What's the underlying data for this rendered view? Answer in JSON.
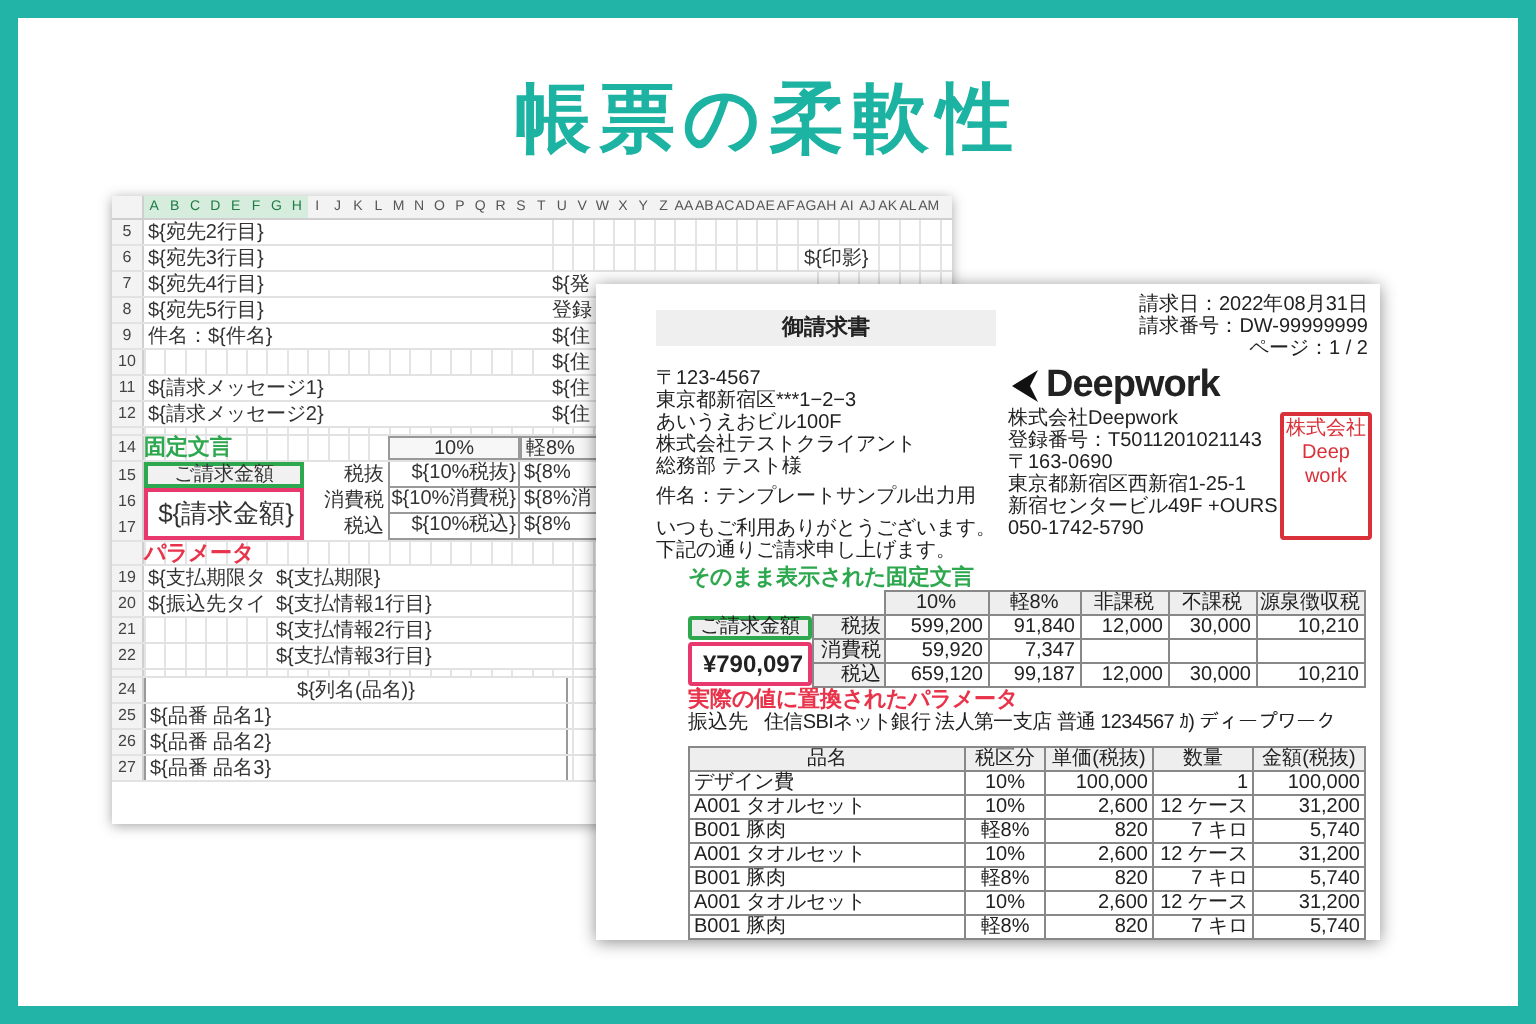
{
  "banner_title": "帳票の柔軟性",
  "spreadsheet": {
    "columns": [
      {
        "label": "A",
        "selected": true
      },
      {
        "label": "B",
        "selected": true
      },
      {
        "label": "C",
        "selected": true
      },
      {
        "label": "D",
        "selected": true
      },
      {
        "label": "E",
        "selected": true
      },
      {
        "label": "F",
        "selected": true
      },
      {
        "label": "G",
        "selected": true
      },
      {
        "label": "H",
        "selected": true
      },
      {
        "label": "I",
        "selected": false
      },
      {
        "label": "J",
        "selected": false
      },
      {
        "label": "K",
        "selected": false
      },
      {
        "label": "L",
        "selected": false
      },
      {
        "label": "M",
        "selected": false
      },
      {
        "label": "N",
        "selected": false
      },
      {
        "label": "O",
        "selected": false
      },
      {
        "label": "P",
        "selected": false
      },
      {
        "label": "Q",
        "selected": false
      },
      {
        "label": "R",
        "selected": false
      },
      {
        "label": "S",
        "selected": false
      },
      {
        "label": "T",
        "selected": false
      },
      {
        "label": "U",
        "selected": false
      },
      {
        "label": "V",
        "selected": false
      },
      {
        "label": "W",
        "selected": false
      },
      {
        "label": "X",
        "selected": false
      },
      {
        "label": "Y",
        "selected": false
      },
      {
        "label": "Z",
        "selected": false
      },
      {
        "label": "AA",
        "selected": false
      },
      {
        "label": "AB",
        "selected": false
      },
      {
        "label": "AC",
        "selected": false
      },
      {
        "label": "AD",
        "selected": false
      },
      {
        "label": "AE",
        "selected": false
      },
      {
        "label": "AF",
        "selected": false
      },
      {
        "label": "AG",
        "selected": false
      },
      {
        "label": "AH",
        "selected": false
      },
      {
        "label": "AI",
        "selected": false
      },
      {
        "label": "AJ",
        "selected": false
      },
      {
        "label": "AK",
        "selected": false
      },
      {
        "label": "AL",
        "selected": false
      },
      {
        "label": "AM",
        "selected": false
      }
    ],
    "rows": [
      {
        "number": "5",
        "left": "${宛先2行目}"
      },
      {
        "number": "6",
        "left": "${宛先3行目}",
        "far": "${印影}"
      },
      {
        "number": "7",
        "left": "${宛先4行目}",
        "right": "${発"
      },
      {
        "number": "8",
        "left": "${宛先5行目}",
        "right": "登録"
      },
      {
        "number": "9",
        "left": "件名：${件名}",
        "right": "${住"
      },
      {
        "number": "10",
        "right": "${住"
      },
      {
        "number": "11",
        "left": "${請求メッセージ1}",
        "right": "${住"
      },
      {
        "number": "12",
        "left": "${請求メッセージ2}",
        "right": "${住"
      }
    ],
    "summary": {
      "row_numbers": [
        "14",
        "15",
        "16",
        "17"
      ],
      "annotation_fixed": "固定文言",
      "headers": [
        "10%",
        "軽8%"
      ],
      "fixed_label": "ご請求金額",
      "amount": "${請求金額}",
      "annotation_param": "パラメータ",
      "rows": [
        {
          "tax_label": "税抜",
          "values": [
            "${10%税抜}",
            "${8%"
          ]
        },
        {
          "tax_label": "消費税",
          "values": [
            "${10%消費税}",
            "${8%消"
          ]
        },
        {
          "tax_label": "税込",
          "values": [
            "${10%税込}",
            "${8%"
          ]
        }
      ]
    },
    "payment_rows": [
      {
        "number": "19",
        "label": "${支払期限タ",
        "value": "${支払期限}"
      },
      {
        "number": "20",
        "label": "${振込先タイ",
        "value": "${支払情報1行目}"
      },
      {
        "number": "21",
        "value": "${支払情報2行目}"
      },
      {
        "number": "22",
        "value": "${支払情報3行目}"
      }
    ],
    "item_header": {
      "number": "24",
      "text": "${列名(品名)}"
    },
    "item_rows": [
      {
        "number": "25",
        "text": "${品番 品名1}"
      },
      {
        "number": "26",
        "text": "${品番 品名2}"
      },
      {
        "number": "27",
        "text": "${品番 品名3}"
      }
    ]
  },
  "invoice": {
    "title": "御請求書",
    "meta": [
      "請求日：2022年08月31日",
      "請求番号：DW-99999999",
      "ページ：1 / 2"
    ],
    "recipient": [
      "〒123-4567",
      "東京都新宿区***1−2−3",
      "あいうえおビル100F",
      "株式会社テストクライアント",
      "総務部 テスト様"
    ],
    "subject": "件名：テンプレートサンプル出力用",
    "greeting": [
      "いつもご利用ありがとうございます。",
      "下記の通りご請求申し上げます。"
    ],
    "company": {
      "logo": "Deepwork",
      "lines": [
        "株式会社Deepwork",
        "登録番号：T5011201021143",
        "〒163-0690",
        "東京都新宿区西新宿1-25-1",
        "新宿センタービル49F +OURS",
        "050-1742-5790"
      ]
    },
    "stamp": [
      "株式会社",
      "Deep",
      "work"
    ],
    "annotation_fixed": "そのまま表示された固定文言",
    "summary": {
      "fixed_label": "ご請求金額",
      "amount": "¥790,097",
      "headers": [
        "10%",
        "軽8%",
        "非課税",
        "不課税",
        "源泉徴収税"
      ],
      "rows": [
        {
          "label": "税抜",
          "values": [
            "599,200",
            "91,840",
            "12,000",
            "30,000",
            "10,210"
          ]
        },
        {
          "label": "消費税",
          "values": [
            "59,920",
            "7,347"
          ]
        },
        {
          "label": "税込",
          "values": [
            "659,120",
            "99,187",
            "12,000",
            "30,000",
            "10,210"
          ]
        }
      ]
    },
    "annotation_param": "実際の値に置換されたパラメータ",
    "bank": {
      "label": "振込先",
      "value": "住信SBIネット銀行 法人第一支店 普通 1234567 ｶ) ディープワーク"
    },
    "items": {
      "columns": [
        "品名",
        "税区分",
        "単価(税抜)",
        "数量",
        "金額(税抜)"
      ],
      "rows": [
        [
          "デザイン費",
          "10%",
          "100,000",
          "1",
          "100,000"
        ],
        [
          "A001 タオルセット",
          "10%",
          "2,600",
          "12 ケース",
          "31,200"
        ],
        [
          "B001 豚肉",
          "軽8%",
          "820",
          "7 キロ",
          "5,740"
        ],
        [
          "A001 タオルセット",
          "10%",
          "2,600",
          "12 ケース",
          "31,200"
        ],
        [
          "B001 豚肉",
          "軽8%",
          "820",
          "7 キロ",
          "5,740"
        ],
        [
          "A001 タオルセット",
          "10%",
          "2,600",
          "12 ケース",
          "31,200"
        ],
        [
          "B001 豚肉",
          "軽8%",
          "820",
          "7 キロ",
          "5,740"
        ]
      ]
    }
  }
}
